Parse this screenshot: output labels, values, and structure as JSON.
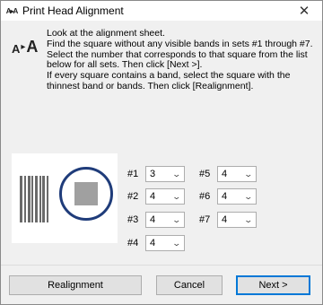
{
  "window": {
    "title": "Print Head Alignment",
    "close_glyph": "✕"
  },
  "instructions": {
    "line1": "Look at the alignment sheet.",
    "line2": "Find the square without any visible bands in sets #1 through #7. Select the number that corresponds to that square from the list below for all sets. Then click [Next >].",
    "line3": "If every square contains a band, select the square with the thinnest band or bands. Then click [Realignment]."
  },
  "sets": [
    {
      "label": "#1",
      "value": "3"
    },
    {
      "label": "#2",
      "value": "4"
    },
    {
      "label": "#3",
      "value": "4"
    },
    {
      "label": "#4",
      "value": "4"
    },
    {
      "label": "#5",
      "value": "4"
    },
    {
      "label": "#6",
      "value": "4"
    },
    {
      "label": "#7",
      "value": "4"
    }
  ],
  "buttons": {
    "realignment": "Realignment",
    "cancel": "Cancel",
    "next": "Next >"
  },
  "colors": {
    "circle_border": "#1f3c7a",
    "focus_border": "#0078d7"
  }
}
